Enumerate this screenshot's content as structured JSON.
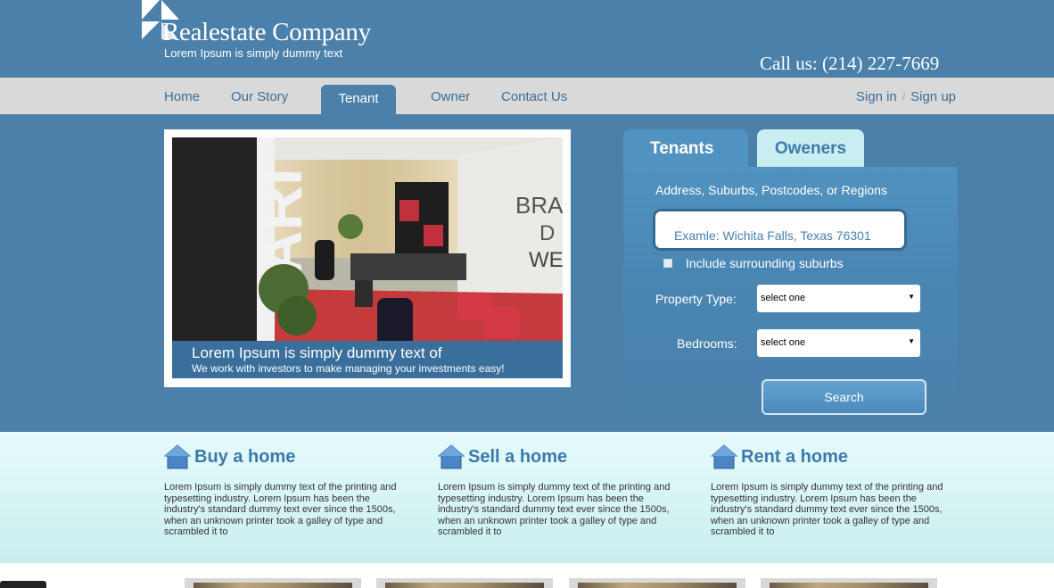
{
  "brand": {
    "title": "Realestate Company",
    "tagline": "Lorem Ipsum is simply dummy text",
    "phone": "Call us: (214) 227-7669"
  },
  "nav": {
    "items": [
      "Home",
      "Our Story",
      "Tenant",
      "Owner",
      "Contact Us"
    ],
    "active": "Tenant",
    "sign_in": "Sign in",
    "separator": "/",
    "sign_up": "Sign up"
  },
  "hero": {
    "caption_title": "Lorem Ipsum is simply dummy text of",
    "caption_sub": "We work with investors to make managing your investments easy!",
    "photo_text": "BRAN D WE"
  },
  "search": {
    "tabs": [
      "Tenants",
      "Oweners"
    ],
    "address_label": "Address, Suburbs, Postcodes, or Regions",
    "address_placeholder": "Examle: Wichita Falls, Texas 76301",
    "include_label": "Include surrounding suburbs",
    "property_type_label": "Property Type:",
    "property_type_value": "select one",
    "bedrooms_label": "Bedrooms:",
    "bedrooms_value": "select one",
    "search_button": "Search"
  },
  "features": [
    {
      "title": "Buy a home",
      "text": "Lorem Ipsum is simply dummy text of the printing and typesetting industry. Lorem Ipsum has been the industry's standard dummy text ever since the 1500s, when an unknown printer took a galley of type and scrambled it to"
    },
    {
      "title": "Sell a home",
      "text": "Lorem Ipsum is simply dummy text of the printing and typesetting industry. Lorem Ipsum has been the industry's standard dummy text ever since the 1500s, when an unknown printer took a galley of type and scrambled it to"
    },
    {
      "title": "Rent a home",
      "text": "Lorem Ipsum is simply dummy text of the printing and typesetting industry. Lorem Ipsum has been the industry's standard dummy text ever since the 1500s, when an unknown printer took a galley of type and scrambled it to"
    }
  ],
  "icons": {
    "logo": "triangle-logo-icon",
    "feature": "house-icon",
    "dropdown": "chevron-down-icon"
  },
  "colors": {
    "primary": "#4a80aa",
    "nav_bg": "#d9d9d9",
    "tab_inactive": "#c9eef1",
    "band": "#e6fbfb"
  }
}
